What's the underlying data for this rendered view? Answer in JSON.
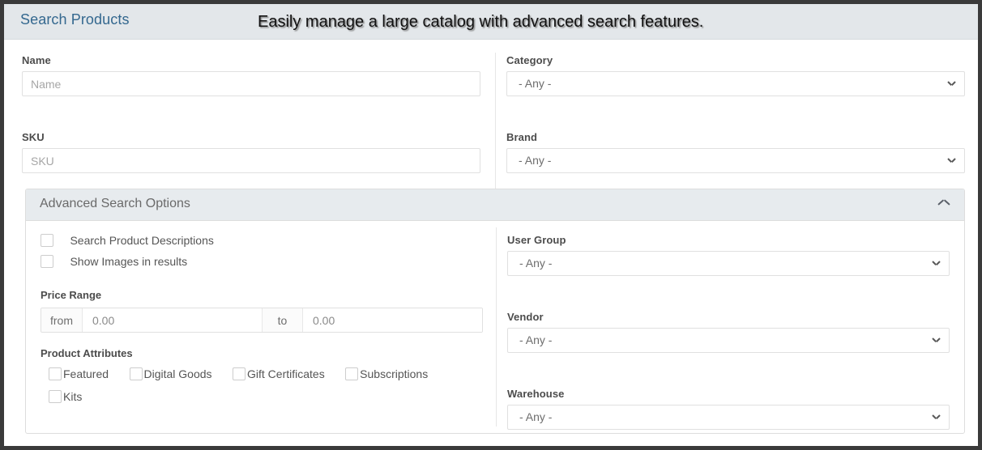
{
  "header": {
    "title": "Search Products",
    "overlay_caption": "Easily manage a large catalog with advanced search features.",
    "title_color": "#34688f",
    "band_color": "#e3e7ea"
  },
  "basic_search": {
    "left": [
      {
        "label": "Name",
        "placeholder": "Name",
        "value": ""
      },
      {
        "label": "SKU",
        "placeholder": "SKU",
        "value": ""
      }
    ],
    "right": [
      {
        "label": "Category",
        "selected": "- Any -"
      },
      {
        "label": "Brand",
        "selected": "- Any -"
      }
    ]
  },
  "advanced": {
    "panel_title": "Advanced Search Options",
    "collapse_icon": "chevron-up-icon",
    "checkboxes": [
      {
        "label": "Search Product Descriptions",
        "checked": false
      },
      {
        "label": "Show Images in results",
        "checked": false
      }
    ],
    "price_range": {
      "label": "Price Range",
      "from_addon": "from",
      "to_addon": "to",
      "from_value": "0.00",
      "to_value": "0.00"
    },
    "product_attributes": {
      "label": "Product Attributes",
      "items": [
        {
          "label": "Featured",
          "checked": false
        },
        {
          "label": "Digital Goods",
          "checked": false
        },
        {
          "label": "Gift Certificates",
          "checked": false
        },
        {
          "label": "Subscriptions",
          "checked": false
        },
        {
          "label": "Kits",
          "checked": false
        }
      ]
    },
    "selects": [
      {
        "label": "User Group",
        "selected": "- Any -"
      },
      {
        "label": "Vendor",
        "selected": "- Any -"
      },
      {
        "label": "Warehouse",
        "selected": "- Any -"
      }
    ]
  }
}
